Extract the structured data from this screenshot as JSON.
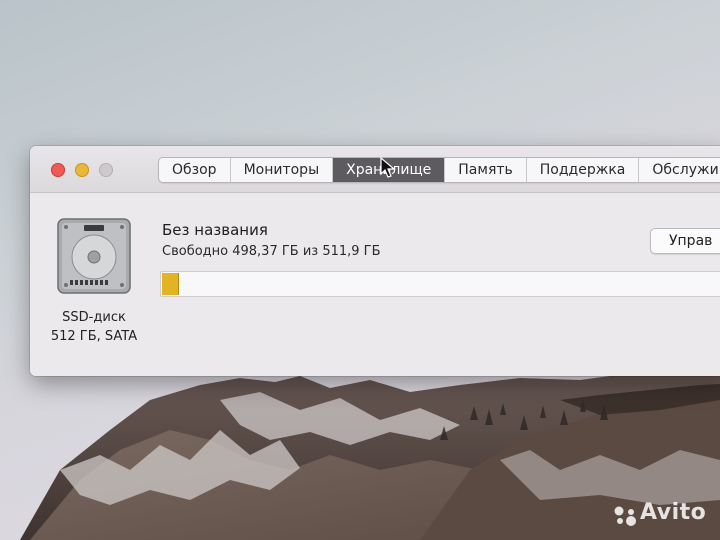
{
  "window": {
    "tabs": [
      {
        "label": "Обзор",
        "active": false
      },
      {
        "label": "Мониторы",
        "active": false
      },
      {
        "label": "Хранилище",
        "active": true
      },
      {
        "label": "Память",
        "active": false
      },
      {
        "label": "Поддержка",
        "active": false
      },
      {
        "label": "Обслужи",
        "active": false
      }
    ],
    "disk": {
      "icon": "hard-drive-icon",
      "type_label": "SSD-диск",
      "spec_label": "512 ГБ, SATA"
    },
    "volume": {
      "name": "Без названия",
      "free_text": "Свободно 498,37 ГБ из 511,9 ГБ",
      "used_fraction": 0.027
    },
    "manage_button": "Управ"
  },
  "colors": {
    "used_bar": "#e2b324",
    "active_tab": "#5d5b60",
    "close": "#ec5b55",
    "minimize": "#e9b739"
  },
  "watermark": "Avito"
}
